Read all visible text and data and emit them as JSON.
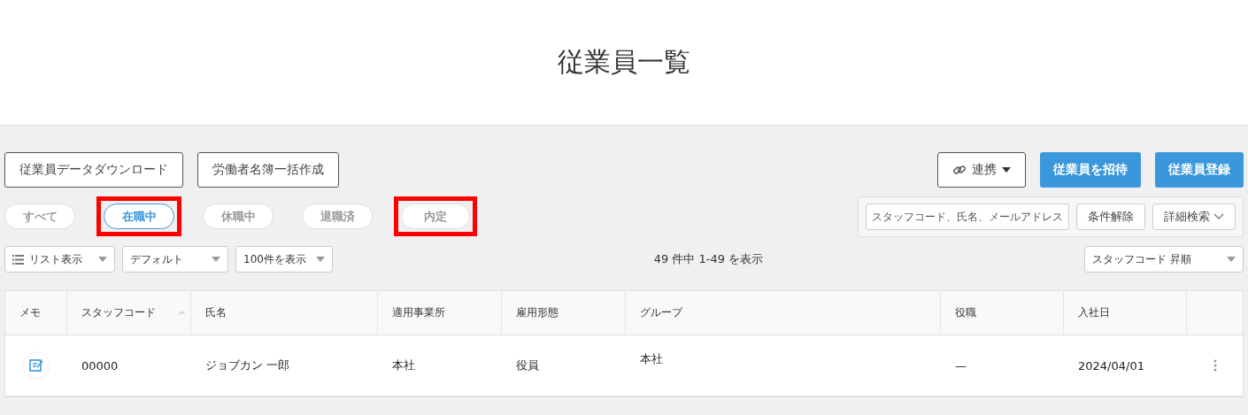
{
  "page_title": "従業員一覧",
  "left_actions": [
    "従業員データダウンロード",
    "労働者名簿一括作成"
  ],
  "link_menu": {
    "label": "連携"
  },
  "primary_actions": [
    "従業員を招待",
    "従業員登録"
  ],
  "status_tabs": [
    {
      "label": "すべて",
      "selected": false,
      "highlighted": false
    },
    {
      "label": "在職中",
      "selected": true,
      "highlighted": true
    },
    {
      "label": "休職中",
      "selected": false,
      "highlighted": false
    },
    {
      "label": "退職済",
      "selected": false,
      "highlighted": false
    },
    {
      "label": "内定",
      "selected": false,
      "highlighted": true
    }
  ],
  "search": {
    "placeholder": "スタッフコード、氏名、メールアドレス",
    "clear_label": "条件解除",
    "advanced_label": "詳細検索"
  },
  "view_selects": [
    {
      "kind": "list",
      "label": "リスト表示"
    },
    {
      "kind": "plain",
      "label": "デフォルト"
    },
    {
      "kind": "plain",
      "label": "100件を表示"
    }
  ],
  "result_count": "49 件中 1-49 を表示",
  "sort_select": "スタッフコード 昇順",
  "table": {
    "columns": [
      {
        "label": "メモ",
        "sorted": false
      },
      {
        "label": "スタッフコード",
        "sorted": true
      },
      {
        "label": "氏名",
        "sorted": false
      },
      {
        "label": "適用事業所",
        "sorted": false
      },
      {
        "label": "雇用形態",
        "sorted": false
      },
      {
        "label": "グループ",
        "sorted": false
      },
      {
        "label": "役職",
        "sorted": false
      },
      {
        "label": "入社日",
        "sorted": false
      }
    ],
    "rows": [
      {
        "code": "00000",
        "name": "ジョブカン 一郎",
        "office": "本社",
        "employment": "役員",
        "group": "本社",
        "position": "—",
        "joined": "2024/04/01"
      }
    ]
  }
}
